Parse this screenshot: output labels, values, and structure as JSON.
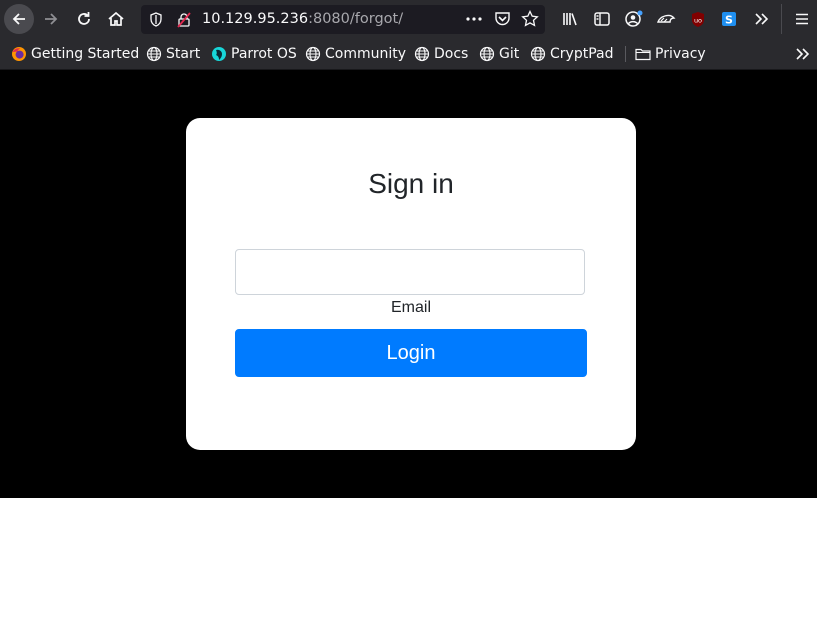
{
  "browser": {
    "url_host": "10.129.95.236",
    "url_rest": ":8080/forgot/",
    "bookmarks": [
      {
        "label": "Getting Started",
        "icon": "firefox-icon"
      },
      {
        "label": "Start",
        "icon": "globe-icon"
      },
      {
        "label": "Parrot OS",
        "icon": "parrot-icon"
      },
      {
        "label": "Community",
        "icon": "globe-icon"
      },
      {
        "label": "Docs",
        "icon": "globe-icon"
      },
      {
        "label": "Git",
        "icon": "globe-icon"
      },
      {
        "label": "CryptPad",
        "icon": "globe-icon"
      },
      {
        "label": "Privacy",
        "icon": "folder-icon"
      }
    ]
  },
  "page": {
    "title": "Sign in",
    "email": {
      "value": "",
      "label": "Email"
    },
    "login_label": "Login"
  },
  "colors": {
    "toolbar": "#2a2a2e",
    "page_background": "#000000",
    "button": "#007bff"
  }
}
